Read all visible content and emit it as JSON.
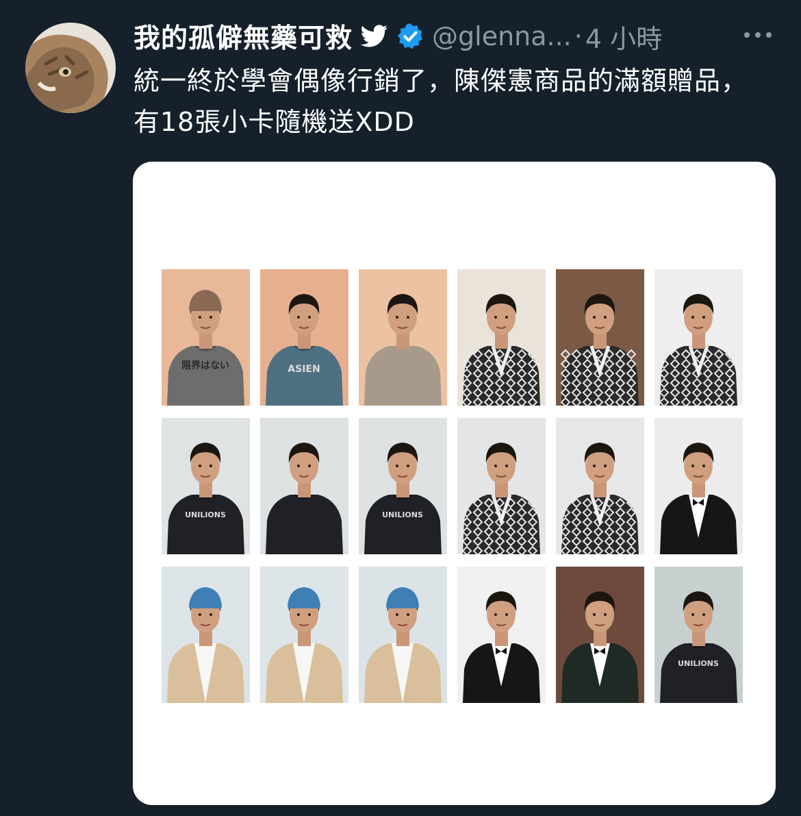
{
  "tweet": {
    "display_name": "我的孤僻無藥可救",
    "handle": "@glenna...",
    "separator": "·",
    "time": "4 小時",
    "text": "統一終於學會偶像行銷了，陳傑憲商品的滿額贈品，有18張小卡隨機送XDD",
    "icons": {
      "avatar": "cat-avatar",
      "bird": "twitter-bird-icon",
      "verified": "verified-badge-icon",
      "more": "more-options-icon"
    }
  },
  "colors": {
    "background": "#15202b",
    "text": "#ffffff",
    "muted": "#8b98a5",
    "verified": "#1d9bf0",
    "media_bg": "#ffffff"
  },
  "media": {
    "cards": [
      {
        "bg": "#e8b898",
        "outfit": "gray-tee",
        "top": "#6d6d6b",
        "hat": "#8b6a55",
        "shirt_text": "限界はない"
      },
      {
        "bg": "#e6b090",
        "outfit": "blue-hoodie",
        "top": "#4f6f82",
        "hat": "",
        "shirt_text": "ASIEN"
      },
      {
        "bg": "#ecc2a2",
        "outfit": "patterned-hoodie",
        "top": "#a89a8a",
        "hat": "",
        "shirt_text": ""
      },
      {
        "bg": "#e9e3da",
        "outfit": "yukata",
        "top": "#2a2a2a",
        "hat": "",
        "shirt_text": ""
      },
      {
        "bg": "#7a5a45",
        "outfit": "yukata",
        "top": "#2a2a2a",
        "hat": "",
        "shirt_text": ""
      },
      {
        "bg": "#eeeeee",
        "outfit": "yukata",
        "top": "#2a2a2a",
        "hat": "",
        "shirt_text": ""
      },
      {
        "bg": "#dfe3e4",
        "outfit": "black-sweatshirt",
        "top": "#1f2127",
        "hat": "",
        "shirt_text": "UNILIONS"
      },
      {
        "bg": "#dde1e2",
        "outfit": "black-sweatshirt",
        "top": "#1f2127",
        "hat": "",
        "shirt_text": ""
      },
      {
        "bg": "#dfe2e3",
        "outfit": "black-sweatshirt",
        "top": "#1f2127",
        "hat": "",
        "shirt_text": "UNILIONS"
      },
      {
        "bg": "#e4e5e6",
        "outfit": "yukata",
        "top": "#2a2a2a",
        "hat": "",
        "shirt_text": ""
      },
      {
        "bg": "#e6e7e8",
        "outfit": "yukata",
        "top": "#2a2a2a",
        "hat": "",
        "shirt_text": ""
      },
      {
        "bg": "#ececec",
        "outfit": "tuxedo",
        "top": "#161616",
        "hat": "",
        "shirt_text": ""
      },
      {
        "bg": "#dce4e8",
        "outfit": "beige-shirt",
        "top": "#d9bf9b",
        "hat": "#3f7fb6",
        "shirt_text": ""
      },
      {
        "bg": "#dde5e9",
        "outfit": "beige-shirt",
        "top": "#d9bf9b",
        "hat": "#3f7fb6",
        "shirt_text": ""
      },
      {
        "bg": "#dbe3e7",
        "outfit": "beige-shirt",
        "top": "#d9bf9b",
        "hat": "#3f7fb6",
        "shirt_text": ""
      },
      {
        "bg": "#f0f0f0",
        "outfit": "tuxedo",
        "top": "#161616",
        "hat": "",
        "shirt_text": ""
      },
      {
        "bg": "#6d4a3d",
        "outfit": "tuxedo-dark",
        "top": "#1f2a25",
        "hat": "",
        "shirt_text": ""
      },
      {
        "bg": "#c8d0cf",
        "outfit": "black-sweatshirt",
        "top": "#1f2127",
        "hat": "",
        "shirt_text": "UNILIONS"
      }
    ]
  }
}
